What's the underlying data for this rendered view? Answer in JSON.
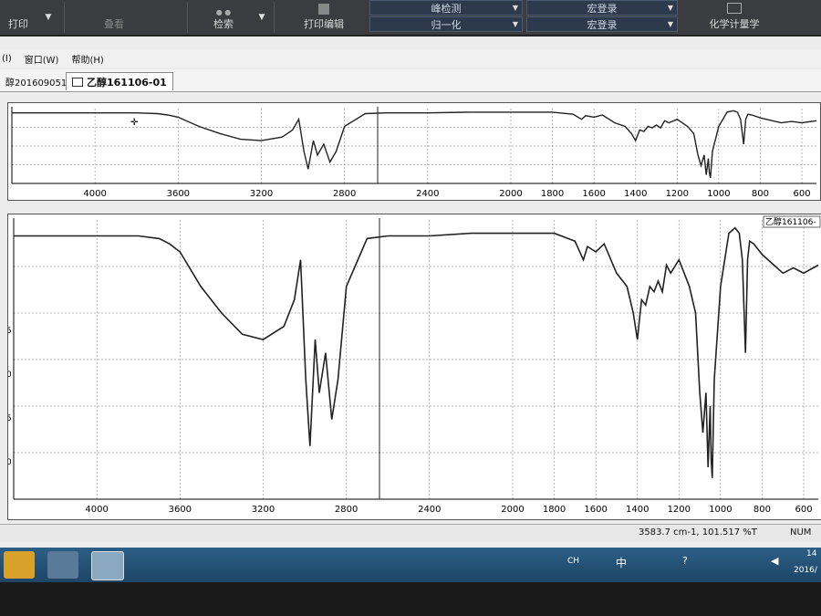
{
  "toolbar": {
    "print_label": "打印",
    "overlay_label": "叠看",
    "search_label": "检索",
    "print_edit_label": "打印编辑",
    "peak_detect_label": "峰检测",
    "normalize_label": "归一化",
    "macro1_label": "宏登录",
    "macro2_label": "宏登录",
    "chem_label": "化学计量学"
  },
  "menu": {
    "item1": "(I)",
    "window": "窗口(W)",
    "help": "帮助(H)"
  },
  "tabs": {
    "tab1": "醇201609051",
    "tab2": "乙醇161106-01"
  },
  "upper_plot": {
    "x_ticks": [
      "4000",
      "3600",
      "3200",
      "2800",
      "2400",
      "2000",
      "1800",
      "1600",
      "1400",
      "1200",
      "1000",
      "800",
      "600"
    ]
  },
  "lower_plot": {
    "legend_label": "乙醇161106-",
    "x_ticks": [
      "4000",
      "3600",
      "3200",
      "2800",
      "2400",
      "2000",
      "1800",
      "1600",
      "1400",
      "1200",
      "1000",
      "800",
      "600"
    ],
    "y_ticks": [
      "5",
      "0",
      "5",
      "0"
    ]
  },
  "status": {
    "readout": "3583.7 cm-1, 101.517 %T",
    "num_lock": "NUM"
  },
  "tray": {
    "ime": "CH",
    "lang": "中",
    "time": "14",
    "date": "2016/"
  },
  "chart_data": [
    {
      "type": "line",
      "title": "",
      "xlabel": "",
      "ylabel": "",
      "x_axis_reversed": true,
      "xlim": [
        4400,
        530
      ],
      "series": [
        {
          "name": "",
          "x": [
            4400,
            3800,
            3700,
            3650,
            3600,
            3500,
            3400,
            3300,
            3200,
            3100,
            3050,
            3020,
            2995,
            2975,
            2950,
            2930,
            2900,
            2870,
            2840,
            2800,
            2700,
            2600,
            2400,
            2200,
            2000,
            1900,
            1800,
            1700,
            1660,
            1640,
            1600,
            1560,
            1500,
            1450,
            1420,
            1400,
            1380,
            1360,
            1340,
            1320,
            1300,
            1280,
            1260,
            1240,
            1200,
            1150,
            1120,
            1100,
            1085,
            1070,
            1060,
            1050,
            1045,
            1040,
            1030,
            1000,
            960,
            930,
            910,
            895,
            880,
            870,
            860,
            840,
            800,
            700,
            650,
            600,
            530
          ],
          "y": [
            99,
            99,
            98,
            96,
            93,
            80,
            70,
            62,
            60,
            65,
            75,
            90,
            45,
            20,
            60,
            40,
            55,
            30,
            45,
            80,
            98,
            99,
            99,
            100,
            100,
            100,
            100,
            97,
            90,
            95,
            93,
            96,
            85,
            80,
            70,
            60,
            75,
            73,
            80,
            78,
            82,
            78,
            88,
            85,
            90,
            80,
            70,
            40,
            25,
            40,
            12,
            35,
            15,
            8,
            45,
            80,
            100,
            102,
            100,
            90,
            55,
            90,
            97,
            96,
            92,
            85,
            87,
            85,
            88
          ]
        }
      ]
    },
    {
      "type": "line",
      "title": "",
      "xlabel": "",
      "ylabel": "",
      "x_axis_reversed": true,
      "xlim": [
        4400,
        530
      ],
      "series": [
        {
          "name": "乙醇161106-",
          "x": [
            4400,
            3800,
            3700,
            3650,
            3600,
            3500,
            3400,
            3300,
            3200,
            3100,
            3050,
            3020,
            2995,
            2975,
            2950,
            2930,
            2900,
            2870,
            2840,
            2800,
            2700,
            2600,
            2400,
            2200,
            2000,
            1900,
            1800,
            1700,
            1660,
            1640,
            1600,
            1560,
            1500,
            1450,
            1420,
            1400,
            1380,
            1360,
            1340,
            1320,
            1300,
            1280,
            1260,
            1240,
            1200,
            1150,
            1120,
            1100,
            1085,
            1070,
            1060,
            1050,
            1045,
            1040,
            1030,
            1000,
            960,
            930,
            910,
            895,
            880,
            870,
            860,
            840,
            800,
            700,
            650,
            600,
            530
          ],
          "y": [
            99,
            99,
            98,
            96,
            93,
            80,
            70,
            62,
            60,
            65,
            75,
            90,
            45,
            20,
            60,
            40,
            55,
            30,
            45,
            80,
            98,
            99,
            99,
            100,
            100,
            100,
            100,
            97,
            90,
            95,
            93,
            96,
            85,
            80,
            70,
            60,
            75,
            73,
            80,
            78,
            82,
            78,
            88,
            85,
            90,
            80,
            70,
            40,
            25,
            40,
            12,
            35,
            15,
            8,
            45,
            80,
            100,
            102,
            100,
            90,
            55,
            90,
            97,
            96,
            92,
            85,
            87,
            85,
            88
          ]
        }
      ]
    }
  ]
}
